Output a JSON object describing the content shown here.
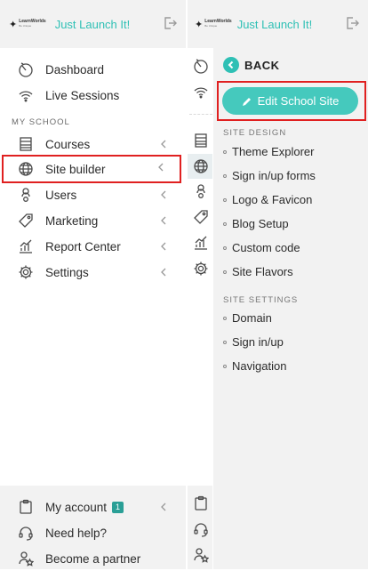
{
  "brand": {
    "name": "Just Launch It!",
    "logo_text": "LearnWorlds",
    "logo_subtext": "Be Unique"
  },
  "nav": {
    "top_items": [
      {
        "label": "Dashboard",
        "icon": "gauge-icon"
      },
      {
        "label": "Live Sessions",
        "icon": "broadcast-icon"
      }
    ],
    "section_label": "MY SCHOOL",
    "school_items": [
      {
        "label": "Courses",
        "icon": "courses-icon"
      },
      {
        "label": "Site builder",
        "icon": "globe-icon"
      },
      {
        "label": "Users",
        "icon": "users-icon"
      },
      {
        "label": "Marketing",
        "icon": "tag-icon"
      },
      {
        "label": "Report Center",
        "icon": "chart-icon"
      },
      {
        "label": "Settings",
        "icon": "gear-icon"
      }
    ],
    "footer_items": [
      {
        "label": "My account",
        "badge": "1",
        "icon": "clipboard-icon"
      },
      {
        "label": "Need help?",
        "icon": "headset-icon"
      },
      {
        "label": "Become a partner",
        "icon": "partner-icon"
      }
    ]
  },
  "sub_panel": {
    "back_label": "BACK",
    "edit_button_label": "Edit School Site",
    "site_design_title": "SITE DESIGN",
    "site_design_items": [
      "Theme Explorer",
      "Sign in/up forms",
      "Logo & Favicon",
      "Blog Setup",
      "Custom code",
      "Site Flavors"
    ],
    "site_settings_title": "SITE SETTINGS",
    "site_settings_items": [
      "Domain",
      "Sign in/up",
      "Navigation"
    ]
  },
  "colors": {
    "accent": "#2fc0b5",
    "button": "#45c9bd",
    "highlight": "#e02020",
    "badge": "#2a9f96"
  }
}
